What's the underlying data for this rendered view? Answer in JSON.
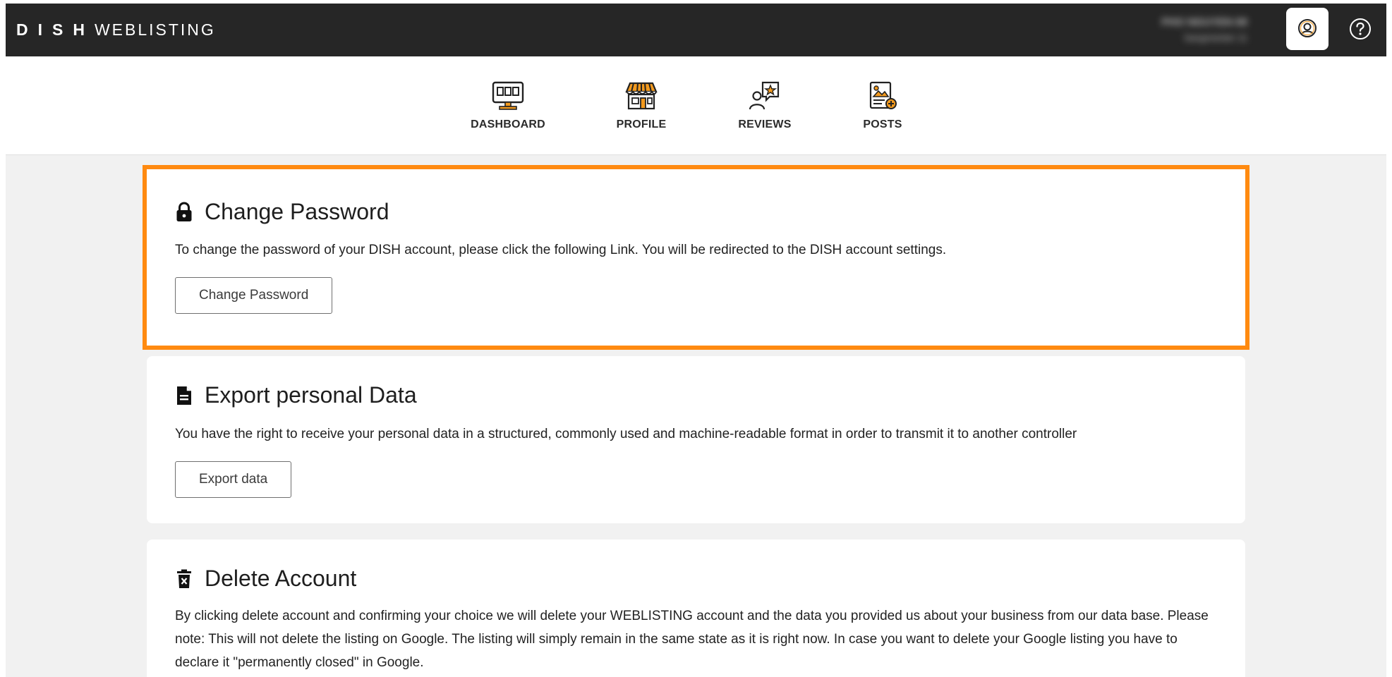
{
  "header": {
    "brand_strong": "DISH",
    "brand_light": "WEBLISTING",
    "account_name": "PHO NGUYEN 68",
    "account_sub": "Sangmeister 11",
    "user_icon": "user-circle-icon",
    "help_icon": "question-circle-icon"
  },
  "nav": {
    "items": [
      {
        "label": "DASHBOARD",
        "icon": "monitor-icon"
      },
      {
        "label": "PROFILE",
        "icon": "storefront-icon"
      },
      {
        "label": "REVIEWS",
        "icon": "review-star-icon"
      },
      {
        "label": "POSTS",
        "icon": "post-image-icon"
      }
    ]
  },
  "change_password": {
    "title": "Change Password",
    "description": "To change the password of your DISH account, please click the following Link. You will be redirected to the DISH account settings.",
    "button_label": "Change Password",
    "icon": "lock-icon"
  },
  "export_data": {
    "title": "Export personal Data",
    "description": "You have the right to receive your personal data in a structured, commonly used and machine-readable format in order to transmit it to another controller",
    "button_label": "Export data",
    "icon": "document-icon"
  },
  "delete_account": {
    "title": "Delete Account",
    "description": "By clicking delete account and confirming your choice we will delete your WEBLISTING account and the data you provided us about your business from our data base. Please note: This will not delete the listing on Google. The listing will simply remain in the same state as it is right now. In case you want to delete your Google listing you have to declare it \"permanently closed\" in Google.",
    "icon": "trash-icon"
  },
  "colors": {
    "topbar": "#262626",
    "accent": "#ff8a10",
    "background": "#f1f1f1"
  }
}
